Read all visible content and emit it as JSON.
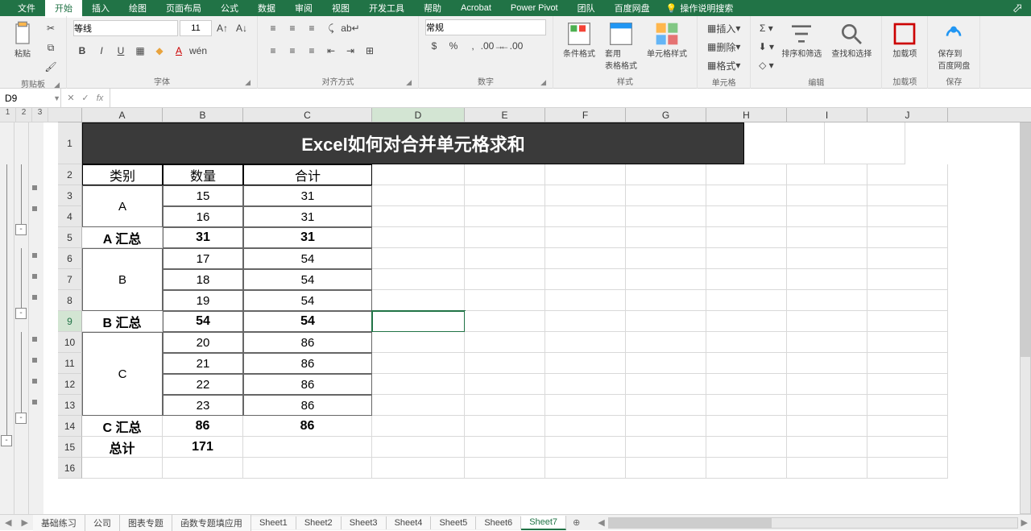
{
  "ribbon_tabs": [
    "文件",
    "开始",
    "插入",
    "绘图",
    "页面布局",
    "公式",
    "数据",
    "审阅",
    "视图",
    "开发工具",
    "帮助",
    "Acrobat",
    "Power Pivot",
    "团队",
    "百度网盘"
  ],
  "active_tab": "开始",
  "tell_me": "操作说明搜索",
  "groups": {
    "clipboard": {
      "paste": "粘贴",
      "label": "剪贴板"
    },
    "font": {
      "name": "等线",
      "size": "11",
      "label": "字体"
    },
    "align": {
      "label": "对齐方式"
    },
    "number": {
      "format": "常规",
      "label": "数字"
    },
    "styles": {
      "cond": "条件格式",
      "table": "套用\n表格格式",
      "cell": "单元格样式",
      "label": "样式"
    },
    "cells": {
      "insert": "插入",
      "delete": "删除",
      "format": "格式",
      "label": "单元格"
    },
    "editing": {
      "sort": "排序和筛选",
      "find": "查找和选择",
      "label": "编辑"
    },
    "addins": {
      "addin": "加载项",
      "label": "加载项"
    },
    "save": {
      "save": "保存到\n百度网盘",
      "label": "保存"
    }
  },
  "name_box": "D9",
  "outline_levels": [
    "1",
    "2",
    "3"
  ],
  "columns": [
    "A",
    "B",
    "C",
    "D",
    "E",
    "F",
    "G",
    "H",
    "I",
    "J"
  ],
  "chart_data": {
    "type": "table",
    "title": "Excel如何对合并单元格求和",
    "headers": [
      "类别",
      "数量",
      "合计"
    ],
    "rows": [
      {
        "r": 3,
        "a": "A",
        "b": "15",
        "c": "31",
        "merge_a": 2
      },
      {
        "r": 4,
        "a": "",
        "b": "16",
        "c": "31"
      },
      {
        "r": 5,
        "a": "A 汇总",
        "b": "31",
        "c": "31",
        "subtotal": true
      },
      {
        "r": 6,
        "a": "B",
        "b": "17",
        "c": "54",
        "merge_a": 3
      },
      {
        "r": 7,
        "a": "",
        "b": "18",
        "c": "54"
      },
      {
        "r": 8,
        "a": "",
        "b": "19",
        "c": "54"
      },
      {
        "r": 9,
        "a": "B 汇总",
        "b": "54",
        "c": "54",
        "subtotal": true
      },
      {
        "r": 10,
        "a": "C",
        "b": "20",
        "c": "86",
        "merge_a": 4
      },
      {
        "r": 11,
        "a": "",
        "b": "21",
        "c": "86"
      },
      {
        "r": 12,
        "a": "",
        "b": "22",
        "c": "86"
      },
      {
        "r": 13,
        "a": "",
        "b": "23",
        "c": "86"
      },
      {
        "r": 14,
        "a": "C 汇总",
        "b": "86",
        "c": "86",
        "subtotal": true
      },
      {
        "r": 15,
        "a": "总计",
        "b": "171",
        "c": "",
        "subtotal": true
      },
      {
        "r": 16,
        "a": "",
        "b": "",
        "c": ""
      }
    ]
  },
  "row_heights": {
    "1": 52,
    "default": 26
  },
  "sheet_tabs": [
    "基础练习",
    "公司",
    "图表专题",
    "函数专题填应用",
    "Sheet1",
    "Sheet2",
    "Sheet3",
    "Sheet4",
    "Sheet5",
    "Sheet6",
    "Sheet7"
  ],
  "active_sheet": "Sheet7",
  "active_cell": "D9"
}
